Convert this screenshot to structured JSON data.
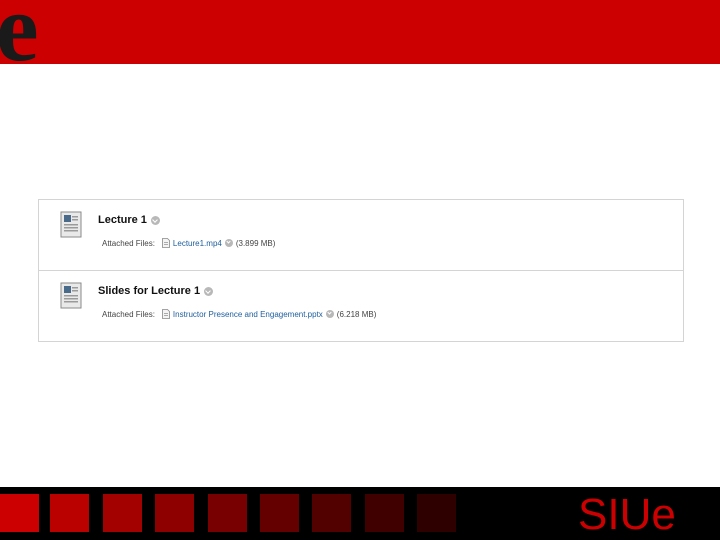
{
  "content_items": [
    {
      "title": "Lecture 1",
      "attached_label": "Attached Files:",
      "file_name": "Lecture1.mp4",
      "file_size": "(3.899 MB)"
    },
    {
      "title": "Slides for Lecture 1",
      "attached_label": "Attached Files:",
      "file_name": "Instructor Presence and Engagement.pptx",
      "file_size": "(6.218 MB)"
    }
  ],
  "branding": {
    "top_logo_letter": "e",
    "bottom_logo": "SIUe",
    "brand_red": "#cc0000",
    "dark": "#000000",
    "link_blue": "#1d5e9c"
  }
}
